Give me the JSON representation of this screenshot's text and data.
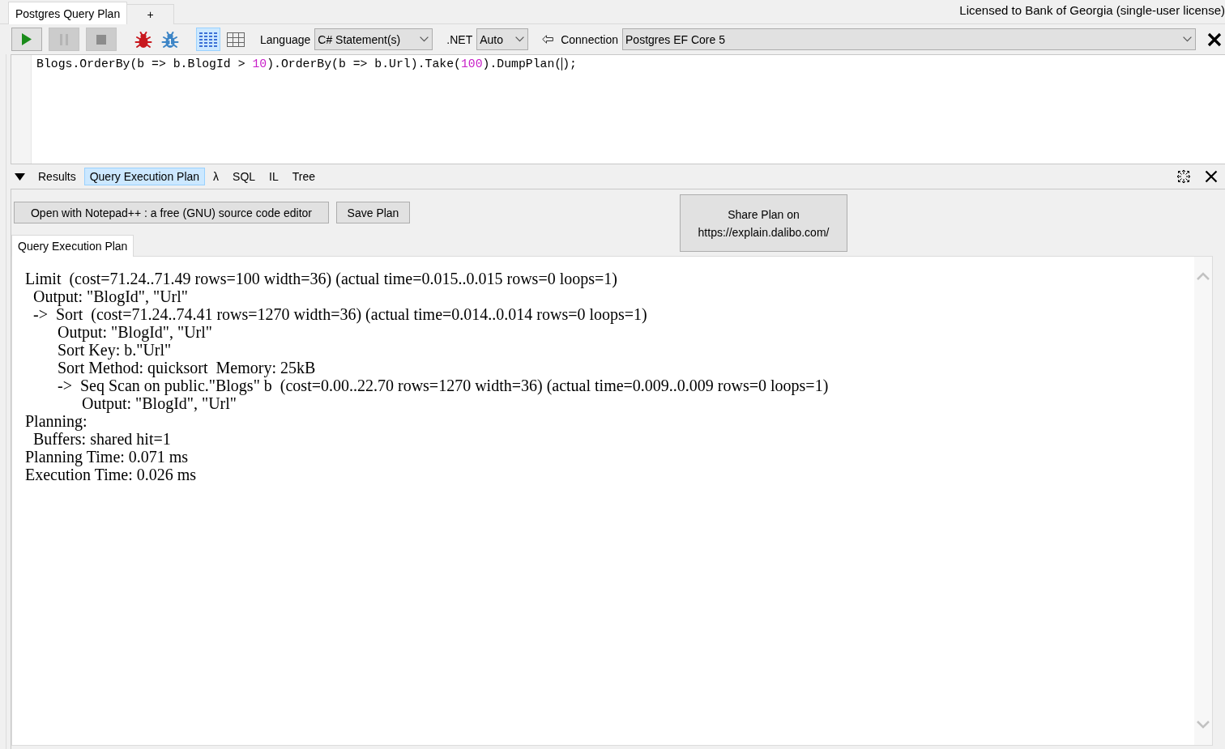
{
  "window": {
    "tabs": [
      {
        "label": "Postgres Query Plan",
        "selected": true
      },
      {
        "label": "+",
        "selected": false
      }
    ],
    "license": "Licensed to Bank of Georgia (single-user license)"
  },
  "toolbar": {
    "run_buttons": [
      {
        "kind": "run",
        "disabled": false
      },
      {
        "kind": "pause",
        "disabled": true
      },
      {
        "kind": "stop",
        "disabled": true
      }
    ],
    "debug_buttons": [
      {
        "color": "#c8181e"
      },
      {
        "color": "#3d85c6",
        "badge": "1"
      }
    ],
    "view_modes": [
      {
        "kind": "text",
        "selected": true
      },
      {
        "kind": "grid",
        "selected": false
      }
    ],
    "language": {
      "label": "Language",
      "value": "C# Statement(s)"
    },
    "framework": {
      "label": ".NET",
      "value": "Auto"
    },
    "connection": {
      "label": "Connection",
      "value": "Postgres EF Core 5"
    }
  },
  "editor": {
    "lines": [
      {
        "tokens": [
          {
            "text": "Blogs.OrderBy(b => b.BlogId > ",
            "kind": "plain",
            "caret_after": false
          },
          {
            "text": "10",
            "kind": "number",
            "caret_after": false
          },
          {
            "text": ").OrderBy(b => b.Url).Take(",
            "kind": "plain",
            "caret_after": false
          },
          {
            "text": "100",
            "kind": "number",
            "caret_after": false
          },
          {
            "text": ").DumpPlan(",
            "kind": "plain",
            "caret_after": true
          },
          {
            "text": ");",
            "kind": "plain",
            "caret_after": false
          }
        ]
      }
    ]
  },
  "output_tabs": [
    {
      "label": "Results",
      "selected": false
    },
    {
      "label": "Query Execution Plan",
      "selected": true
    },
    {
      "label": "λ",
      "selected": false
    },
    {
      "label": "SQL",
      "selected": false
    },
    {
      "label": "IL",
      "selected": false
    },
    {
      "label": "Tree",
      "selected": false
    }
  ],
  "plan_panel": {
    "actions": [
      {
        "kind": "open",
        "label": "Open with Notepad++ : a free (GNU) source code editor"
      },
      {
        "kind": "save",
        "label": "Save Plan"
      },
      {
        "kind": "share",
        "label": "Share Plan on https://explain.dalibo.com/"
      }
    ],
    "tabs": [
      {
        "label": "Query Execution Plan",
        "selected": true
      }
    ],
    "plan": [
      {
        "text": "Limit  (cost=71.24..71.49 rows=100 width=36) (actual time=0.015..0.015 rows=0 loops=1)",
        "children": [
          {
            "text": "Output: \"BlogId\", \"Url\""
          },
          {
            "text": "->  Sort  (cost=71.24..74.41 rows=1270 width=36) (actual time=0.014..0.014 rows=0 loops=1)",
            "children": [
              {
                "text": "Output: \"BlogId\", \"Url\""
              },
              {
                "text": "Sort Key: b.\"Url\""
              },
              {
                "text": "Sort Method: quicksort  Memory: 25kB"
              },
              {
                "text": "->  Seq Scan on public.\"Blogs\" b  (cost=0.00..22.70 rows=1270 width=36) (actual time=0.009..0.009 rows=0 loops=1)",
                "children": [
                  {
                    "text": "Output: \"BlogId\", \"Url\""
                  }
                ]
              }
            ]
          }
        ]
      },
      {
        "text": "Planning:",
        "children": [
          {
            "text": "Buffers: shared hit=1"
          }
        ]
      },
      {
        "text": "Planning Time: 0.071 ms"
      },
      {
        "text": "Execution Time: 0.026 ms"
      }
    ]
  }
}
